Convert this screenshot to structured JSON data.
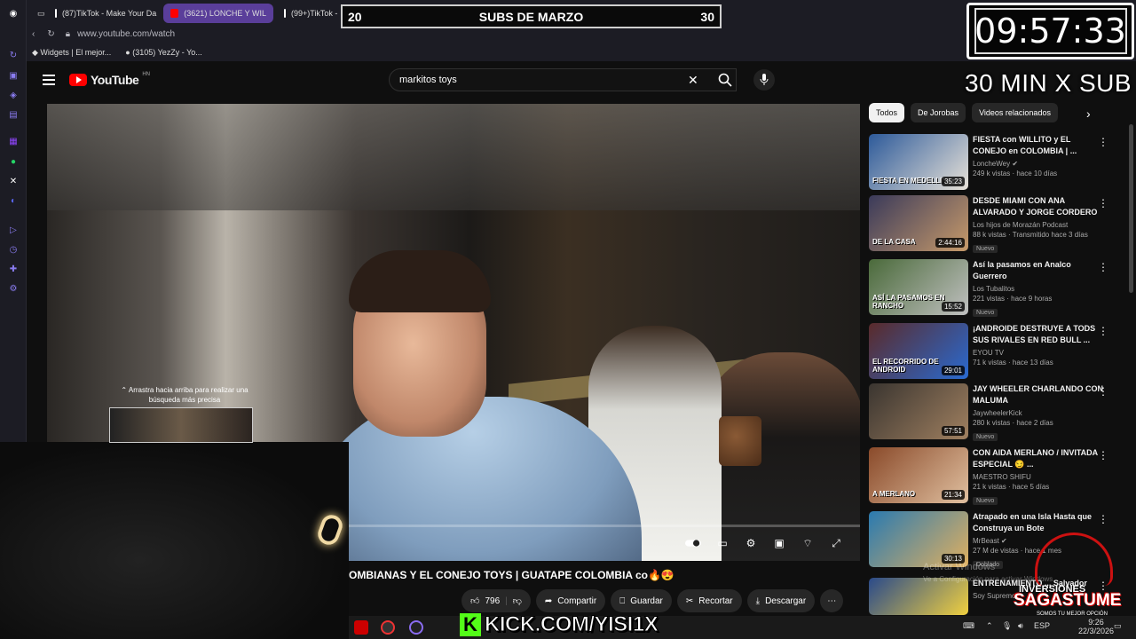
{
  "browser": {
    "tabs": [
      {
        "label": "(87)TikTok - Make Your Da",
        "active": false
      },
      {
        "label": "(3621) LONCHE Y WIL",
        "active": true
      },
      {
        "label": "(99+)TikTok -",
        "active": false
      }
    ],
    "url": "www.youtube.com/watch",
    "bookmarks": [
      "Widgets | El mejor...",
      "(3105) YezZy - Yo..."
    ]
  },
  "youtube": {
    "logo_text": "YouTube",
    "country_code": "HN",
    "search_value": "markitos toys",
    "video_title": "OMBIANAS Y EL CONEJO TOYS | GUATAPE COLOMBIA co🔥😍",
    "actions": {
      "likes": "796",
      "share": "Compartir",
      "save": "Guardar",
      "clip": "Recortar",
      "download": "Descargar"
    },
    "chips": [
      "Todos",
      "De Jorobas",
      "Videos relacionados"
    ],
    "recommendations": [
      {
        "title": "FIESTA con WILLITO y EL CONEJO en COLOMBIA | ...",
        "channel": "LoncheWey",
        "verified": true,
        "meta": "249 k vistas · hace 10 días",
        "duration": "35:23",
        "badge": ""
      },
      {
        "title": "DESDE MIAMI CON ANA ALVARADO Y JORGE CORDERO",
        "channel": "Los hijos de Morazán Podcast",
        "verified": false,
        "meta": "88 k vistas · Transmitido hace 3 días",
        "duration": "2:44:16",
        "badge": "Nuevo"
      },
      {
        "title": "Así la pasamos en Analco Guerrero",
        "channel": "Los Tubalitos",
        "verified": false,
        "meta": "221 vistas · hace 9 horas",
        "duration": "15:52",
        "badge": "Nuevo"
      },
      {
        "title": "¡ANDROIDE DESTRUYE A TODS SUS RIVALES EN RED BULL ...",
        "channel": "EYOU TV",
        "verified": false,
        "meta": "71 k vistas · hace 13 días",
        "duration": "29:01",
        "badge": ""
      },
      {
        "title": "JAY WHEELER CHARLANDO CON MALUMA",
        "channel": "JaywheelerKick",
        "verified": false,
        "meta": "280 k vistas · hace 2 días",
        "duration": "57:51",
        "badge": "Nuevo"
      },
      {
        "title": "CON AIDA MERLANO / INVITADA ESPECIAL 😏 ...",
        "channel": "MAESTRO SHIFU",
        "verified": false,
        "meta": "21 k vistas · hace 5 días",
        "duration": "21:34",
        "badge": "Nuevo"
      },
      {
        "title": "Atrapado en una Isla Hasta que Construya un Bote",
        "channel": "MrBeast",
        "verified": true,
        "meta": "27 M de vistas · hace 1 mes",
        "duration": "30:13",
        "badge": "Doblado"
      },
      {
        "title": "ENTRENAMIENTO ... Salvador",
        "channel": "Soy Supremo",
        "verified": false,
        "meta": "",
        "duration": "",
        "badge": ""
      }
    ],
    "thumb_texts": [
      "FIESTA EN MEDELLIN",
      "DE LA CASA",
      "ASÍ LA PASAMOS EN RANCHO",
      "EL RECORRIDO DE ANDROID",
      "",
      "A MERLANO",
      "",
      ""
    ]
  },
  "overlay": {
    "subs_left": "20",
    "subs_title": "SUBS DE MARZO",
    "subs_right": "30",
    "timer": "09:57:33",
    "timer_caption": "30 MIN X SUB",
    "kick_url": "KICK.COM/YISI1X",
    "swipe_hint": "⌃ Arrastra hacia arriba para realizar una búsqueda más precisa",
    "sponsor_top": "INVERSIONES",
    "sponsor_name": "SAGASTUME",
    "sponsor_tagline": "SOMOS TU MEJOR OPCIÓN",
    "watermark_title": "Activar Windows",
    "watermark_sub": "Ve a Configuración para activar Windows."
  },
  "taskbar": {
    "language": "ESP",
    "time": "9:26",
    "date": "22/3/2026"
  },
  "colors": {
    "yt_red": "#ff0000",
    "kick_green": "#53fc18",
    "browser_accent": "#5a3e9a"
  }
}
